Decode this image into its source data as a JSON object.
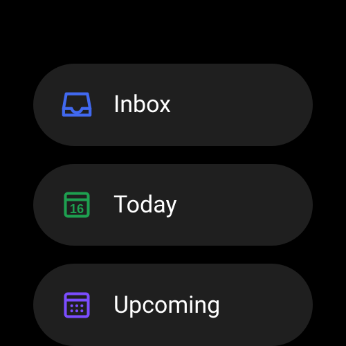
{
  "nav": {
    "items": [
      {
        "label": "Inbox",
        "icon": "inbox-icon",
        "color": "#4169f0"
      },
      {
        "label": "Today",
        "icon": "calendar-today-icon",
        "color": "#1ea050",
        "day": "16"
      },
      {
        "label": "Upcoming",
        "icon": "calendar-upcoming-icon",
        "color": "#7b4dff"
      }
    ]
  }
}
